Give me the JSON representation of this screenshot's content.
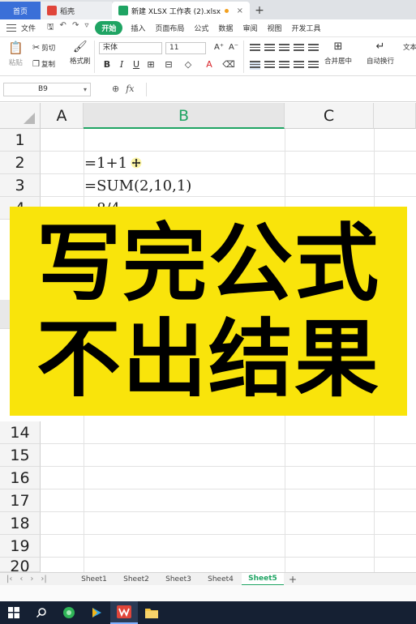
{
  "tabs": {
    "home": "首页",
    "docer": "稻壳",
    "file": "新建 XLSX 工作表 (2).xlsx",
    "close": "×",
    "new_tab": "+"
  },
  "menu": {
    "file": "文件",
    "start": "开始",
    "items": [
      "插入",
      "页面布局",
      "公式",
      "数据",
      "审阅",
      "视图",
      "开发工具"
    ]
  },
  "toolbar": {
    "paste": "粘贴",
    "cut": "剪切",
    "copy": "复制",
    "format_painter": "格式刷",
    "font_name": "宋体",
    "font_size": "11",
    "merge_center": "合并居中",
    "wrap_text": "自动换行",
    "text_label": "文本"
  },
  "formula_bar": {
    "cell_ref": "B9",
    "fx": "fx",
    "value": ""
  },
  "grid": {
    "columns": [
      "A",
      "B",
      "C"
    ],
    "selected_column": "B",
    "rows_top": [
      "1",
      "2",
      "3",
      "4"
    ],
    "rows_bottom": [
      "14",
      "15",
      "16",
      "17",
      "18",
      "19",
      "20"
    ],
    "cells": {
      "b2": "=1+1",
      "b3": "=SUM(2,10,1)",
      "b4": "=8/4"
    }
  },
  "banner": {
    "line1": "写完公式",
    "line2": "不出结果",
    "bg_color": "#f9e40b"
  },
  "sheets": {
    "tabs": [
      "Sheet1",
      "Sheet2",
      "Sheet3",
      "Sheet4",
      "Sheet5"
    ],
    "active": "Sheet5",
    "add": "+"
  },
  "colors": {
    "accent": "#1fa463",
    "home_tab": "#3a6fd8",
    "taskbar": "#152033"
  }
}
